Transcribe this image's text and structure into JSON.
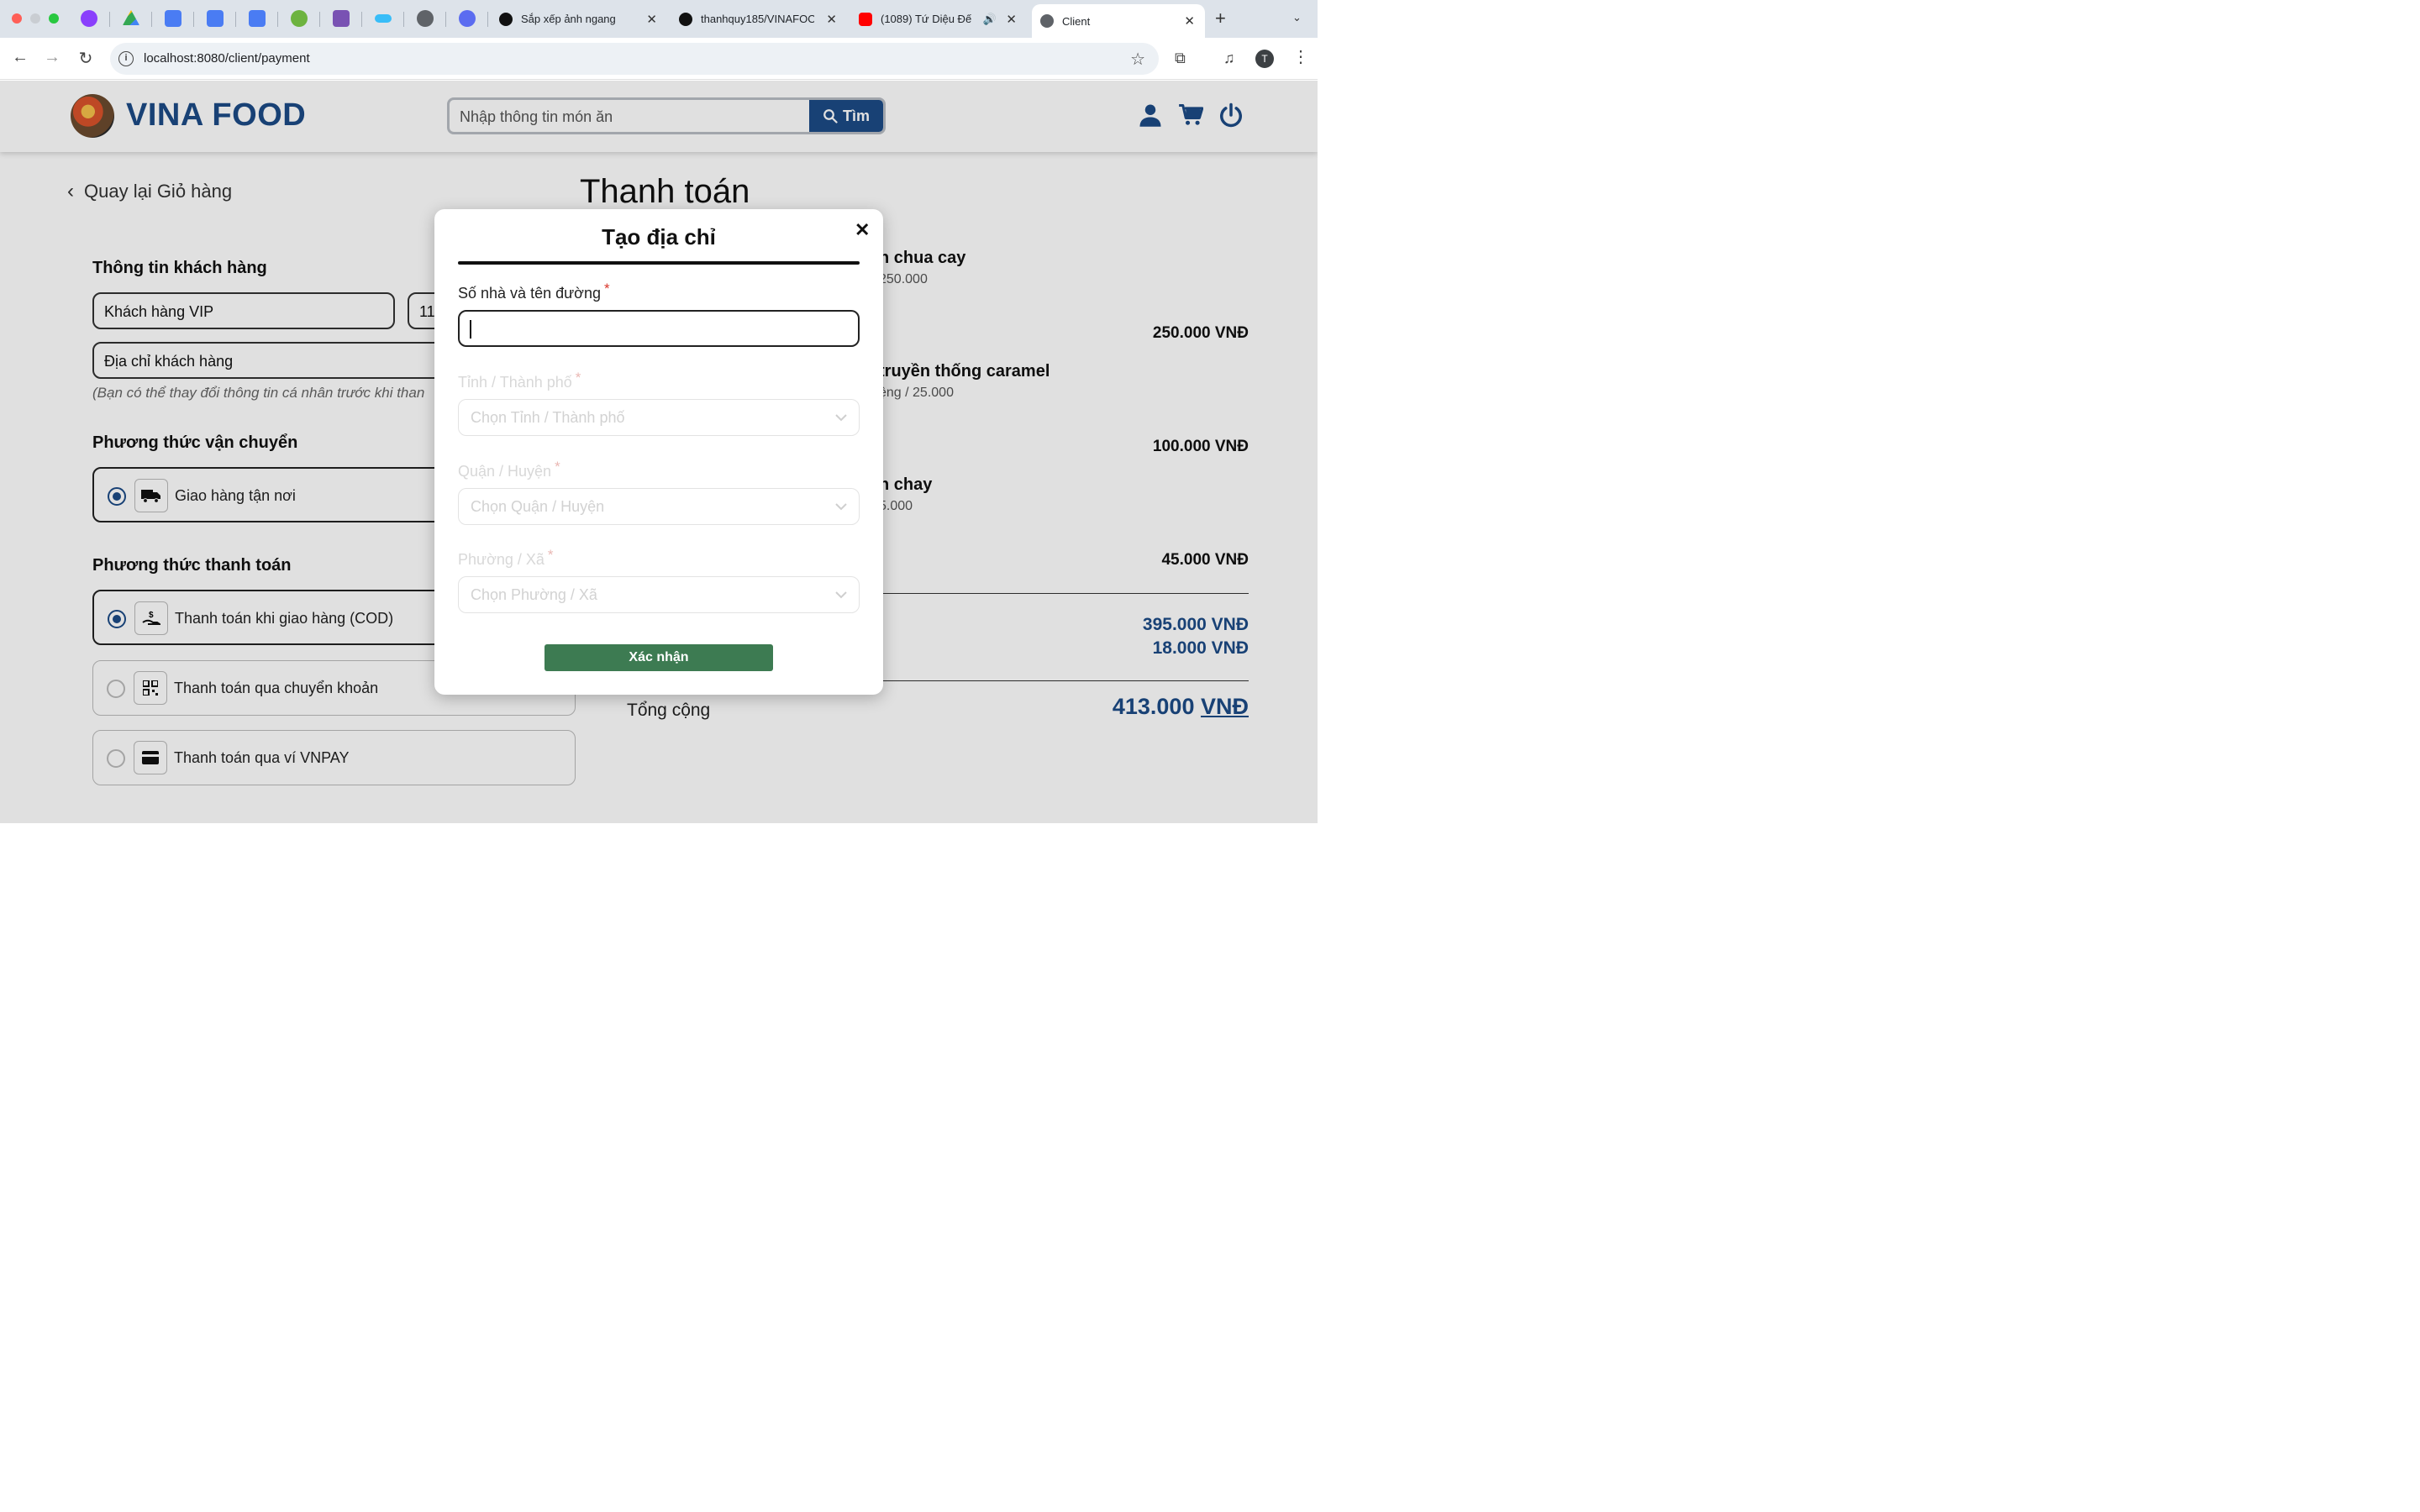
{
  "browser": {
    "tabs": [
      {
        "label": "Sắp xếp ảnh ngang",
        "icon": "openai-icon"
      },
      {
        "label": "thanhquy185/VINAFOOD",
        "icon": "github-icon"
      },
      {
        "label": "(1089) Tứ Diệu Đế",
        "icon": "youtube-icon"
      },
      {
        "label": "Client",
        "icon": "globe-icon"
      }
    ],
    "url": "localhost:8080/client/payment",
    "profile_initial": "T"
  },
  "header": {
    "logo_text": "VINA FOOD",
    "search_placeholder": "Nhập thông tin món ăn",
    "search_button": "Tìm"
  },
  "page": {
    "back_link": "Quay lại Giỏ hàng",
    "title": "Thanh toán"
  },
  "customer": {
    "section_title": "Thông tin khách hàng",
    "name_value": "Khách hàng VIP",
    "phone_value": "11",
    "address_value": "Địa chỉ khách hàng",
    "hint": "(Bạn có thể thay đổi thông tin cá nhân trước khi than"
  },
  "shipping": {
    "section_title": "Phương thức vận chuyển",
    "options": [
      {
        "label": "Giao hàng tận nơi",
        "selected": true
      }
    ]
  },
  "payment": {
    "section_title": "Phương thức thanh toán",
    "options": [
      {
        "label": "Thanh toán khi giao hàng (COD)",
        "selected": true
      },
      {
        "label": "Thanh toán qua chuyển khoản",
        "selected": false
      },
      {
        "label": "Thanh toán qua ví VNPAY",
        "selected": false
      }
    ]
  },
  "order": {
    "items": [
      {
        "name": "n chua cay",
        "sub": "250.000",
        "price": "250.000 VNĐ"
      },
      {
        "name": "truyền thống caramel",
        "sub": "ệng / 25.000",
        "price": "100.000 VNĐ"
      },
      {
        "name": "n chay",
        "sub": "5.000",
        "price": "45.000 VNĐ"
      }
    ],
    "subtotal": "395.000 VNĐ",
    "shipping_fee": "18.000 VNĐ",
    "total_label": "Tổng cộng",
    "total_amount": "413.000",
    "total_currency": "VNĐ"
  },
  "modal": {
    "title": "Tạo địa chỉ",
    "street_label": "Số nhà và tên đường",
    "required_mark": "*",
    "province_label": "Tỉnh / Thành phố",
    "province_placeholder": "Chọn Tỉnh / Thành phố",
    "district_label": "Quận / Huyện",
    "district_placeholder": "Chọn Quận / Huyện",
    "ward_label": "Phường / Xã",
    "ward_placeholder": "Chọn Phường / Xã",
    "confirm_button": "Xác nhận"
  },
  "colors": {
    "brand": "#1c4a86",
    "confirm": "#3d7b52",
    "required": "#d9362b"
  }
}
